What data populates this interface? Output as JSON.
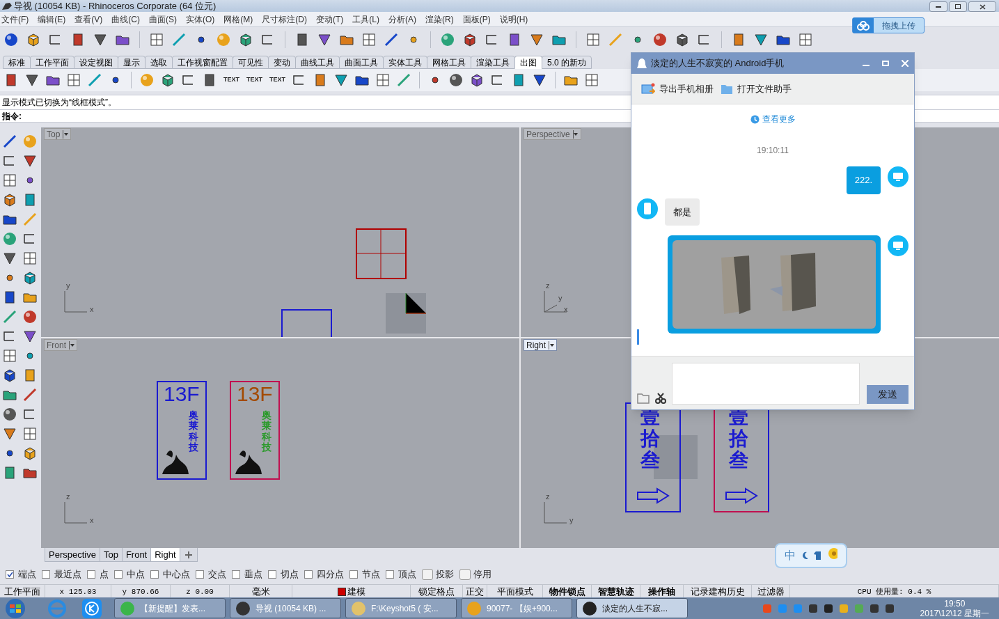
{
  "window": {
    "title": "导视 (10054 KB) - Rhinoceros Corporate (64 位元)"
  },
  "menu": [
    "文件(F)",
    "编辑(E)",
    "查看(V)",
    "曲线(C)",
    "曲面(S)",
    "实体(O)",
    "网格(M)",
    "尺寸标注(D)",
    "变动(T)",
    "工具(L)",
    "分析(A)",
    "渲染(R)",
    "面板(P)",
    "说明(H)"
  ],
  "upload_button": "拖拽上传",
  "toolbar_tabs": [
    {
      "label": "标准",
      "selected": false
    },
    {
      "label": "工作平面",
      "selected": false
    },
    {
      "label": "设定视图",
      "selected": false
    },
    {
      "label": "显示",
      "selected": false
    },
    {
      "label": "选取",
      "selected": false
    },
    {
      "label": "工作视窗配置",
      "selected": false
    },
    {
      "label": "可见性",
      "selected": false
    },
    {
      "label": "变动",
      "selected": false
    },
    {
      "label": "曲线工具",
      "selected": false
    },
    {
      "label": "曲面工具",
      "selected": false
    },
    {
      "label": "实体工具",
      "selected": false
    },
    {
      "label": "网格工具",
      "selected": false
    },
    {
      "label": "渲染工具",
      "selected": false
    },
    {
      "label": "出图",
      "selected": true
    },
    {
      "label": "5.0 的新功",
      "selected": false
    }
  ],
  "toolbar_texts": [
    "TEXT",
    "TEXT",
    "TEXT"
  ],
  "command": {
    "history": "显示模式已切换为“线框模式”。",
    "prompt": "指令:"
  },
  "viewports": [
    {
      "title": "Top",
      "active": false,
      "axes": [
        "y",
        "x"
      ]
    },
    {
      "title": "Perspective",
      "active": false,
      "axes": [
        "z",
        "y",
        "x"
      ]
    },
    {
      "title": "Front",
      "active": false,
      "axes": [
        "z",
        "x"
      ],
      "model_texts": [
        "13F",
        "奥莱科技",
        "13F",
        "奥莱科技"
      ]
    },
    {
      "title": "Right",
      "active": true,
      "axes": [
        "z",
        "y"
      ],
      "model_texts": [
        "壹拾叁",
        "壹拾叁"
      ]
    }
  ],
  "viewport_tabs": [
    {
      "label": "Perspective",
      "selected": false
    },
    {
      "label": "Top",
      "selected": false
    },
    {
      "label": "Front",
      "selected": false
    },
    {
      "label": "Right",
      "selected": true
    }
  ],
  "osnaps": [
    {
      "kind": "check",
      "label": "端点",
      "checked": true
    },
    {
      "kind": "check",
      "label": "最近点",
      "checked": false
    },
    {
      "kind": "check",
      "label": "点",
      "checked": false
    },
    {
      "kind": "check",
      "label": "中点",
      "checked": false
    },
    {
      "kind": "check",
      "label": "中心点",
      "checked": false
    },
    {
      "kind": "check",
      "label": "交点",
      "checked": false
    },
    {
      "kind": "check",
      "label": "垂点",
      "checked": false
    },
    {
      "kind": "check",
      "label": "切点",
      "checked": false
    },
    {
      "kind": "check",
      "label": "四分点",
      "checked": false
    },
    {
      "kind": "check",
      "label": "节点",
      "checked": false
    },
    {
      "kind": "check",
      "label": "顶点",
      "checked": false
    },
    {
      "kind": "toggle",
      "label": "投影",
      "checked": false
    },
    {
      "kind": "toggle",
      "label": "停用",
      "checked": false
    }
  ],
  "status_bar": [
    {
      "kind": "plain",
      "text": "工作平面"
    },
    {
      "kind": "coord",
      "text": "x 125.03"
    },
    {
      "kind": "coord",
      "text": "y 870.66"
    },
    {
      "kind": "coord",
      "text": "z 0.00"
    },
    {
      "kind": "plain",
      "text": "毫米"
    },
    {
      "kind": "layer",
      "text": "建模",
      "color": "#cc0000"
    },
    {
      "kind": "plain",
      "text": "锁定格点"
    },
    {
      "kind": "plain",
      "text": "正交"
    },
    {
      "kind": "plain",
      "text": "平面模式"
    },
    {
      "kind": "bold",
      "text": "物件锁点"
    },
    {
      "kind": "bold",
      "text": "智慧轨迹"
    },
    {
      "kind": "bold",
      "text": "操作轴"
    },
    {
      "kind": "plain",
      "text": "记录建构历史"
    },
    {
      "kind": "plain",
      "text": "过滤器"
    },
    {
      "kind": "coord",
      "text": "CPU 使用量: 0.4 %"
    }
  ],
  "ime": {
    "label": "中"
  },
  "chat": {
    "title": "淡定的人生不寂寞的 Android手机",
    "actions": [
      "导出手机相册",
      "打开文件助手"
    ],
    "more": "查看更多",
    "timestamp": "19:10:11",
    "messages": [
      {
        "outgoing": true,
        "kind": "text",
        "text": "222."
      },
      {
        "outgoing": false,
        "kind": "text",
        "text": "都是"
      },
      {
        "outgoing": true,
        "kind": "picture"
      }
    ],
    "send": "发送"
  },
  "taskbar": {
    "tasks": [
      {
        "label": "【新提醒】发表...",
        "selected": false
      },
      {
        "label": "导视 (10054 KB) ...",
        "selected": false
      },
      {
        "label": "F:\\Keyshot5 ( 安...",
        "selected": false
      },
      {
        "label": "90077- 【娱+900...",
        "selected": false
      },
      {
        "label": "淡定的人生不寂...",
        "selected": true
      }
    ],
    "time": "19:50",
    "date": "2017\\12\\12 星期一"
  }
}
